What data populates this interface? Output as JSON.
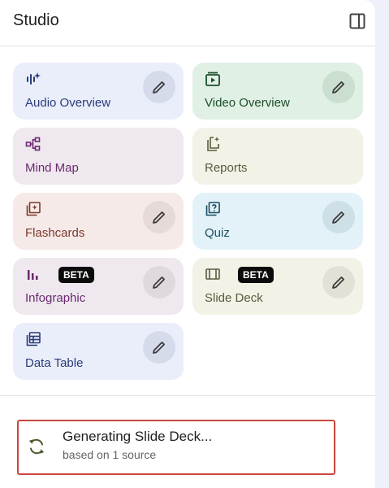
{
  "header": {
    "title": "Studio",
    "collapse_icon": "panel-collapse-icon"
  },
  "tiles": {
    "audio": {
      "label": "Audio Overview",
      "icon": "waveform-sparkle-icon",
      "color": "#2a3a78"
    },
    "video": {
      "label": "Video Overview",
      "icon": "video-play-icon",
      "color": "#1d4d2b"
    },
    "mind_map": {
      "label": "Mind Map",
      "icon": "mind-map-icon",
      "color": "#6a2a6e"
    },
    "reports": {
      "label": "Reports",
      "icon": "reports-sparkle-icon",
      "color": "#5c5a3c"
    },
    "flashcards": {
      "label": "Flashcards",
      "icon": "flashcards-icon",
      "color": "#7a3a2c"
    },
    "quiz": {
      "label": "Quiz",
      "icon": "quiz-icon",
      "color": "#1a4e60"
    },
    "infographic": {
      "label": "Infographic",
      "badge": "BETA",
      "icon": "bar-chart-icon",
      "color": "#6a2a6e"
    },
    "slide_deck": {
      "label": "Slide Deck",
      "badge": "BETA",
      "icon": "slides-icon",
      "color": "#5c5a3c"
    },
    "data_table": {
      "label": "Data Table",
      "icon": "table-icon",
      "color": "#2a3a78"
    }
  },
  "generating": {
    "title": "Generating Slide Deck...",
    "subtitle": "based on 1 source",
    "icon": "sync-icon",
    "highlight_color": "#c9463d"
  }
}
